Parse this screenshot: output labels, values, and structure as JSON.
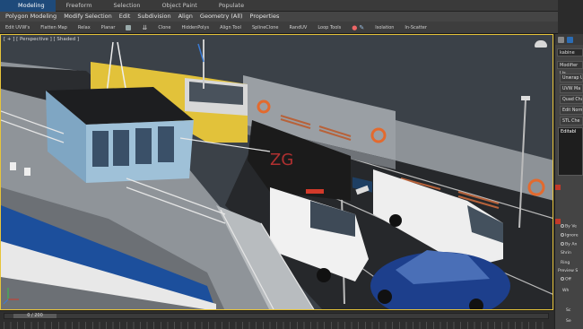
{
  "ribbon_tabs": [
    "Modeling",
    "Freeform",
    "Selection",
    "Object Paint",
    "Populate"
  ],
  "menu_items": [
    "Polygon Modeling",
    "Modify Selection",
    "Edit",
    "Subdivision",
    "Align",
    "Geometry (All)",
    "Properties"
  ],
  "tool_items": [
    "Edit UVW's",
    "Flatten Map",
    "Relax",
    "Planar",
    "",
    "",
    "Clone",
    "HiddenPolys",
    "Align Tool",
    "SplineClone",
    "RandUV",
    "Loop Tools",
    "",
    "Isolation",
    "In-Scatter"
  ],
  "viewport": {
    "label": "[ + ] [ Perspective ] [ Shaded ]"
  },
  "command_panel": {
    "object_name": "kabine",
    "modifier_list": "Modifier Lis",
    "modifiers": [
      "Unwrap U",
      "UVW Ma",
      "Quad Cha",
      "Edit Norm",
      "STL Che"
    ],
    "stack_item": "Editabl",
    "options": [
      "By Ve",
      "Ignore",
      "By An",
      "Shrin",
      "Ring"
    ],
    "preview_label": "Preview S",
    "preview_off": "Off",
    "wh": "Wh",
    "bottom_labels": [
      "Sc",
      "Se"
    ]
  },
  "timeline": {
    "frame_readout": "0 / 200"
  },
  "colors": {
    "active_tab": "#1e4a7a",
    "viewport_border": "#e7c43a",
    "truck_yellow": "#e2c23a",
    "car_blue": "#1d3f8c"
  }
}
